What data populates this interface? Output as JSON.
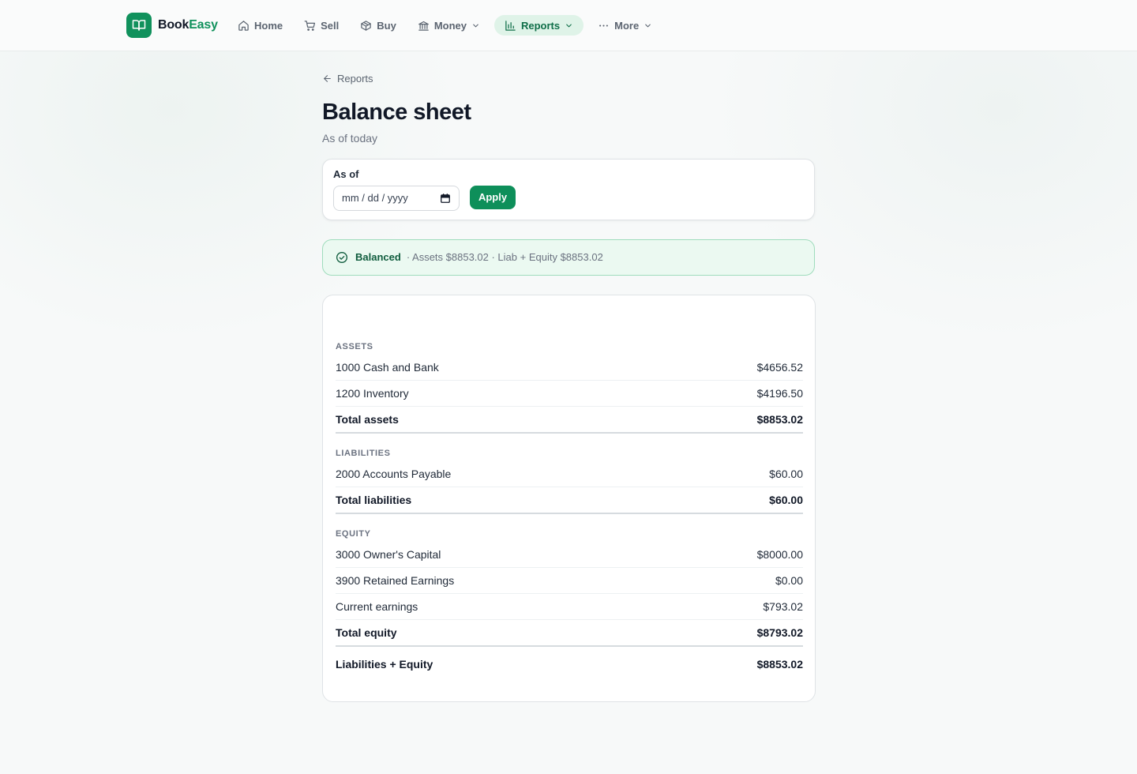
{
  "brand": {
    "part1": "Book",
    "part2": "Easy",
    "accent": "#10915c"
  },
  "nav": {
    "items": [
      {
        "label": "Home",
        "icon": "home-icon"
      },
      {
        "label": "Sell",
        "icon": "cart-icon"
      },
      {
        "label": "Buy",
        "icon": "box-icon"
      },
      {
        "label": "Money",
        "icon": "bank-icon",
        "dropdown": true
      },
      {
        "label": "Reports",
        "icon": "bar-chart-icon",
        "dropdown": true,
        "active": true
      },
      {
        "label": "More",
        "icon": "more-dots-icon",
        "dropdown": true
      }
    ]
  },
  "page": {
    "back_label": "Reports",
    "title": "Balance sheet",
    "subtitle": "As of today"
  },
  "filter": {
    "label": "As of",
    "date_placeholder": "mm / dd / yyyy",
    "apply_label": "Apply"
  },
  "status": {
    "label": "Balanced",
    "detail": "· Assets $8853.02 · Liab + Equity $8853.02",
    "color": "#0f5c3d"
  },
  "sheet": {
    "assets": {
      "heading": "ASSETS",
      "rows": [
        {
          "name": "1000 Cash and Bank",
          "amount": "$4656.52"
        },
        {
          "name": "1200 Inventory",
          "amount": "$4196.50"
        }
      ],
      "total": {
        "name": "Total assets",
        "amount": "$8853.02"
      }
    },
    "liabilities": {
      "heading": "LIABILITIES",
      "rows": [
        {
          "name": "2000 Accounts Payable",
          "amount": "$60.00"
        }
      ],
      "total": {
        "name": "Total liabilities",
        "amount": "$60.00"
      }
    },
    "equity": {
      "heading": "EQUITY",
      "rows": [
        {
          "name": "3000 Owner's Capital",
          "amount": "$8000.00"
        },
        {
          "name": "3900 Retained Earnings",
          "amount": "$0.00"
        },
        {
          "name": "Current earnings",
          "amount": "$793.02"
        }
      ],
      "total": {
        "name": "Total equity",
        "amount": "$8793.02"
      }
    },
    "grand_total": {
      "name": "Liabilities + Equity",
      "amount": "$8853.02"
    }
  }
}
